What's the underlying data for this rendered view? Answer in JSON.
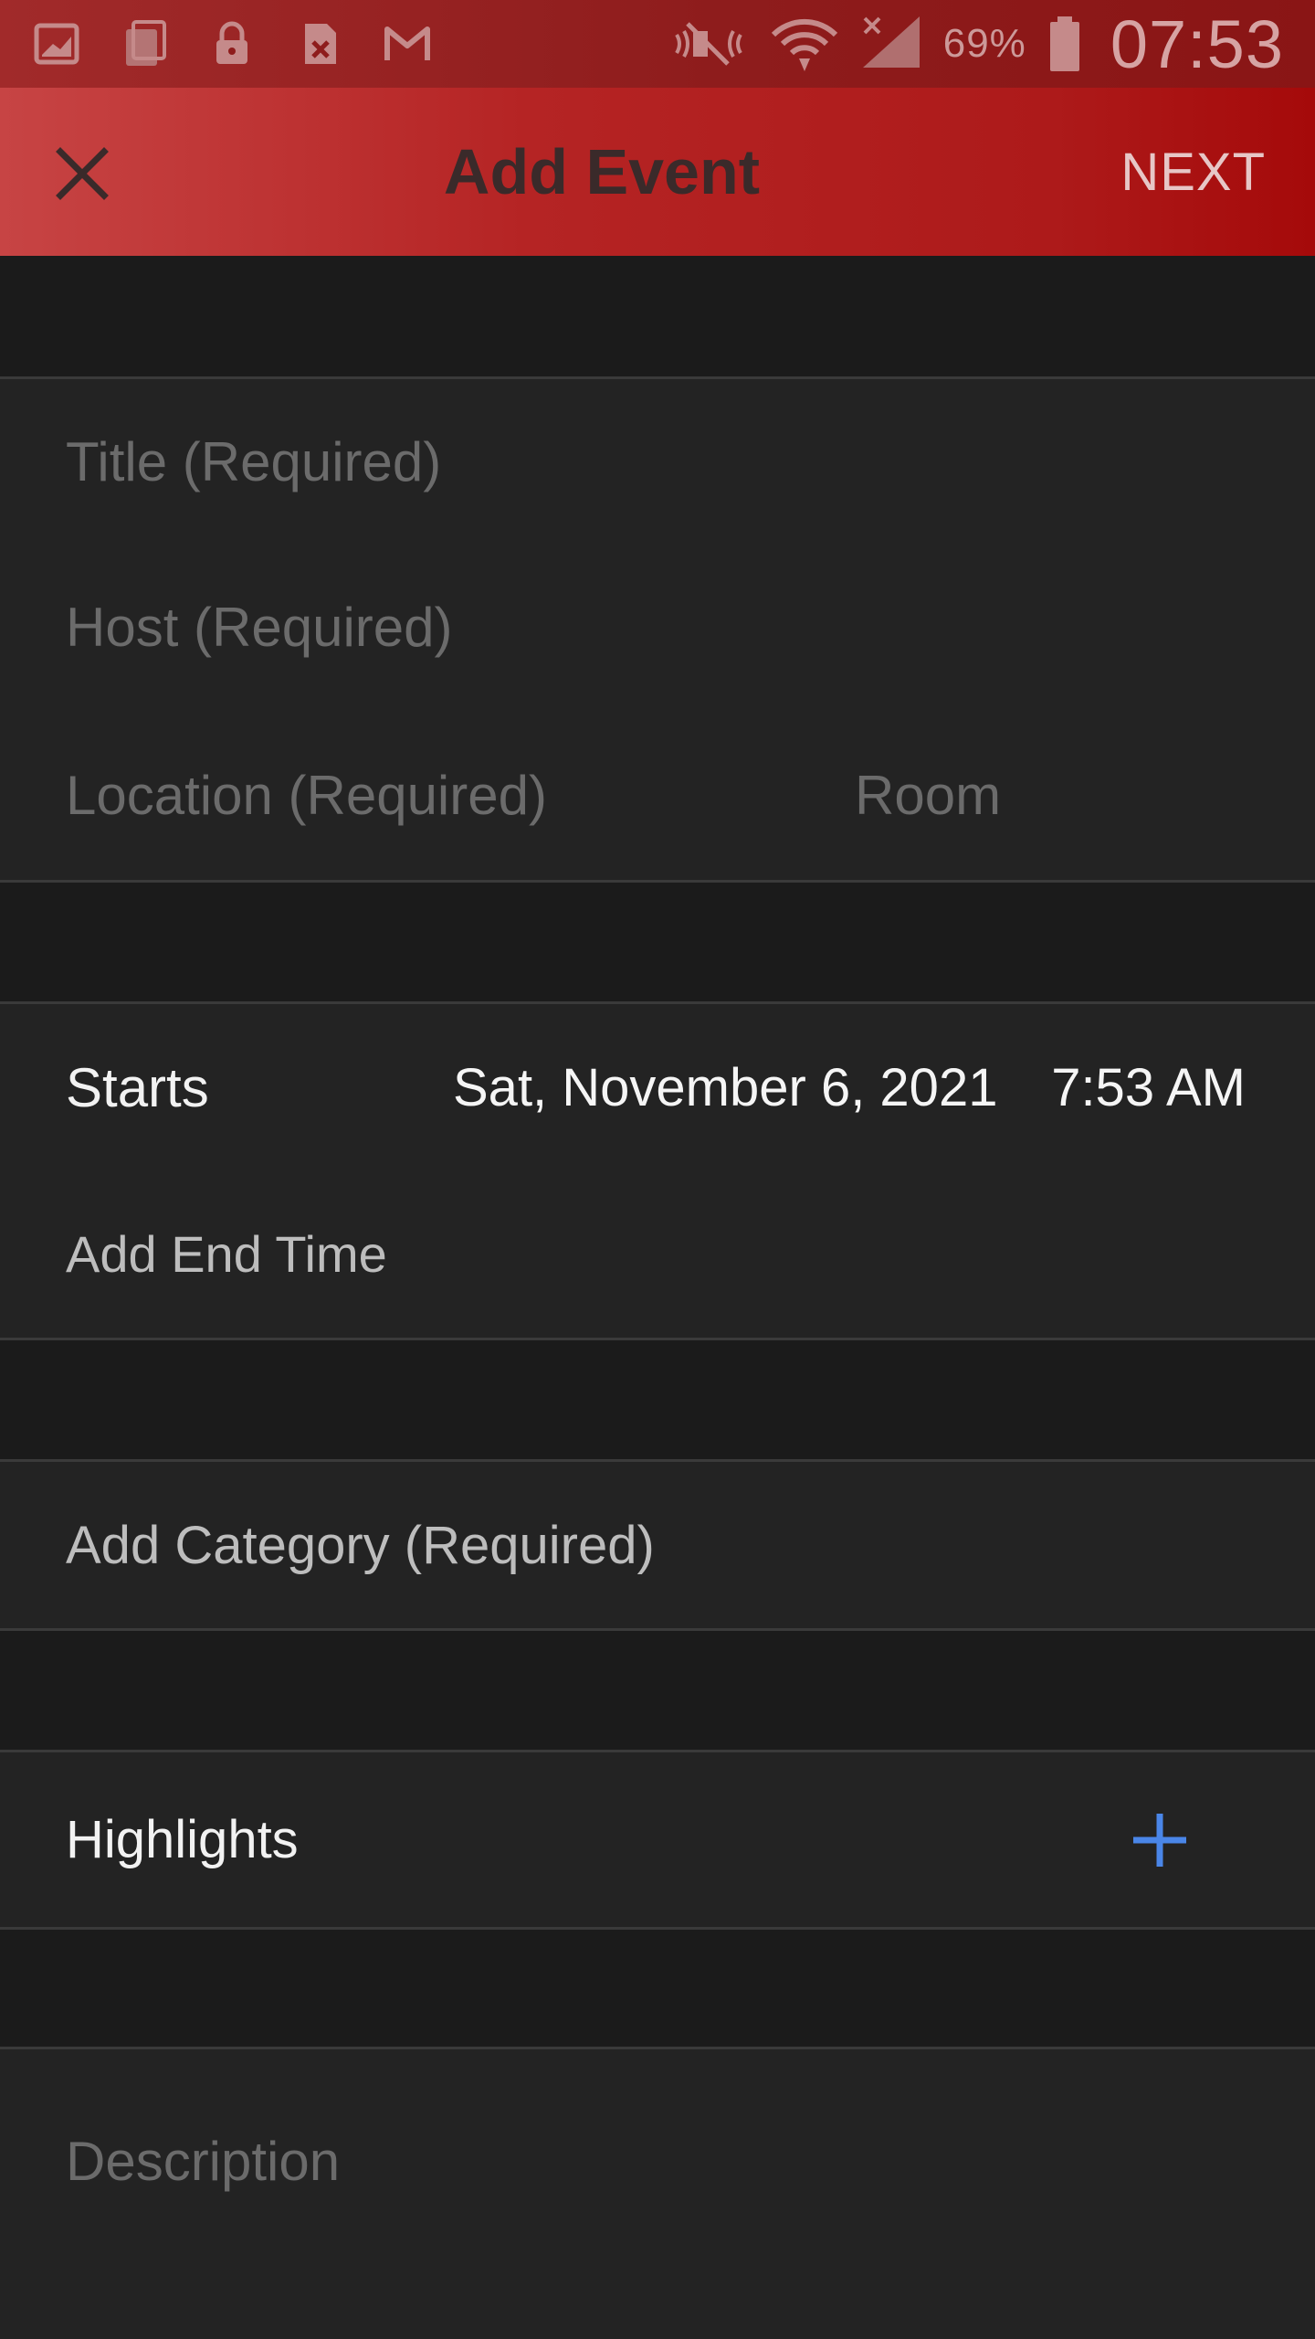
{
  "status_bar": {
    "icons": [
      "image-icon",
      "copy-icon",
      "lock-icon",
      "sim-x-icon",
      "gmail-icon",
      "mute-icon",
      "wifi-icon",
      "signal-icon",
      "battery-icon"
    ],
    "battery_percent": "69%",
    "time": "07:53"
  },
  "app_bar": {
    "close_icon": "close-icon",
    "title": "Add Event",
    "next_label": "NEXT",
    "accent_color": "#b01c1c"
  },
  "form": {
    "title_placeholder": "Title (Required)",
    "host_placeholder": "Host (Required)",
    "location_placeholder": "Location (Required)",
    "room_placeholder": "Room",
    "starts_label": "Starts",
    "start_date": "Sat, November 6, 2021",
    "start_time": "7:53 AM",
    "end_time_label": "Add End Time",
    "category_label": "Add Category (Required)",
    "highlights_label": "Highlights",
    "highlights_add_icon": "plus-icon",
    "description_placeholder": "Description",
    "plus_color": "#4a86e8"
  }
}
